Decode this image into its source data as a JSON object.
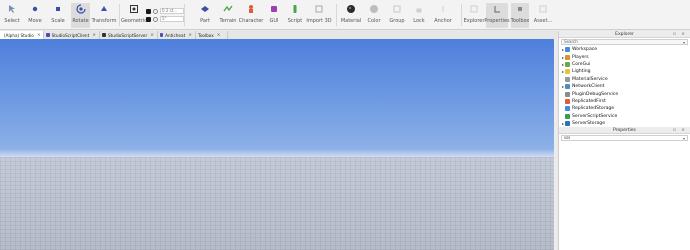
{
  "ribbon": {
    "tools": [
      {
        "id": "select",
        "label": "Select",
        "icon": "cursor-icon"
      },
      {
        "id": "move",
        "label": "Move",
        "icon": "move-icon"
      },
      {
        "id": "scale",
        "label": "Scale",
        "icon": "scale-icon"
      },
      {
        "id": "rotate",
        "label": "Rotate",
        "icon": "rotate-icon"
      },
      {
        "id": "transform",
        "label": "Transform",
        "icon": "transform-icon"
      },
      {
        "id": "geometric",
        "label": "Geometric",
        "icon": "geometric-icon"
      },
      {
        "id": "part",
        "label": "Part",
        "icon": "part-icon"
      },
      {
        "id": "terrain",
        "label": "Terrain",
        "icon": "terrain-icon"
      },
      {
        "id": "character",
        "label": "Character",
        "icon": "character-icon"
      },
      {
        "id": "gui",
        "label": "GUI",
        "icon": "gui-icon"
      },
      {
        "id": "script",
        "label": "Script",
        "icon": "script-icon"
      },
      {
        "id": "import3d",
        "label": "Import 3D",
        "icon": "import-icon"
      },
      {
        "id": "material",
        "label": "Material",
        "icon": "material-icon"
      },
      {
        "id": "color",
        "label": "Color",
        "icon": "color-icon"
      },
      {
        "id": "group",
        "label": "Group",
        "icon": "group-icon"
      },
      {
        "id": "lock",
        "label": "Lock",
        "icon": "lock-icon"
      },
      {
        "id": "anchor",
        "label": "Anchor",
        "icon": "anchor-icon"
      },
      {
        "id": "explorer",
        "label": "Explorer",
        "icon": "explorer-icon"
      },
      {
        "id": "properties",
        "label": "Properties",
        "icon": "properties-icon"
      },
      {
        "id": "toolbox",
        "label": "Toolbox",
        "icon": "toolbox-icon"
      },
      {
        "id": "asset",
        "label": "Asset...",
        "icon": "asset-icon"
      }
    ],
    "snap_move_value": "0.2 st...",
    "snap_rotate_value": "5°"
  },
  "tabs": [
    {
      "label": "(Alpha) Studio",
      "icon": "place-icon",
      "active": true
    },
    {
      "label": "StudioScriptClient",
      "icon": "script-icon"
    },
    {
      "label": "StudioScriptServer",
      "icon": "script-icon"
    },
    {
      "label": "Anticheat",
      "icon": "script-icon"
    },
    {
      "label": "Toolbox",
      "icon": "toolbox-icon"
    }
  ],
  "explorer": {
    "title": "Explorer",
    "search_placeholder": "Search",
    "items": [
      {
        "name": "Workspace",
        "icon": "workspace-icon",
        "color": "#4b8bd6",
        "expandable": true
      },
      {
        "name": "Players",
        "icon": "players-icon",
        "color": "#d9922c",
        "expandable": true
      },
      {
        "name": "CoreGui",
        "icon": "coregui-icon",
        "color": "#6aa84f",
        "expandable": true
      },
      {
        "name": "Lighting",
        "icon": "lighting-icon",
        "color": "#e8c33a",
        "expandable": true
      },
      {
        "name": "MaterialService",
        "icon": "material-service-icon",
        "color": "#999999",
        "expandable": false
      },
      {
        "name": "NetworkClient",
        "icon": "network-icon",
        "color": "#4a8fc4",
        "expandable": true
      },
      {
        "name": "PluginDebugService",
        "icon": "plugin-debug-icon",
        "color": "#8c8c8c",
        "expandable": false
      },
      {
        "name": "ReplicatedFirst",
        "icon": "replicated-first-icon",
        "color": "#e05d3a",
        "expandable": false
      },
      {
        "name": "ReplicatedStorage",
        "icon": "replicated-storage-icon",
        "color": "#3d8ed8",
        "expandable": false
      },
      {
        "name": "ServerScriptService",
        "icon": "server-script-icon",
        "color": "#3c9a4a",
        "expandable": false
      },
      {
        "name": "ServerStorage",
        "icon": "server-storage-icon",
        "color": "#2f6fb4",
        "expandable": true
      }
    ]
  },
  "properties": {
    "title": "Properties",
    "filter_value": "sss"
  }
}
